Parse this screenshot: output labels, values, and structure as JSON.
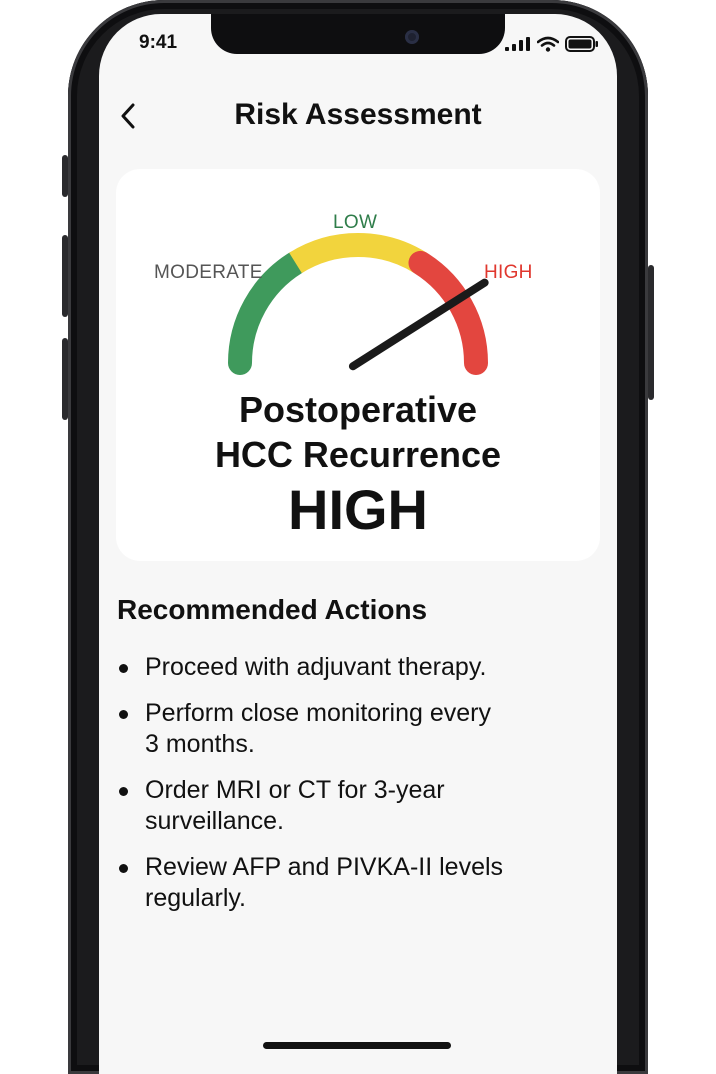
{
  "status_bar": {
    "time": "9:41",
    "icons": [
      "cellular-signal-icon",
      "wifi-icon",
      "battery-icon"
    ]
  },
  "nav": {
    "back_icon": "chevron-left-icon",
    "title": "Risk Assessment"
  },
  "gauge": {
    "labels": {
      "low": "LOW",
      "moderate": "MODERATE",
      "high": "HIGH"
    },
    "colors": {
      "low": "#f2d43d",
      "moderate": "#3f9a5c",
      "high": "#e3463f",
      "low_label": "#2f7d4a",
      "moderate_label": "#555555",
      "high_label": "#e0372e"
    },
    "needle_level": 0.82
  },
  "result": {
    "title_line1": "Postoperative",
    "title_line2": "HCC Recurrence",
    "level": "HIGH"
  },
  "recommendations": {
    "title": "Recommended Actions",
    "items": [
      {
        "line1": "Proceed with adjuvant therapy.",
        "line2": ""
      },
      {
        "line1": "Perform close monitoring every",
        "line2": "3 months."
      },
      {
        "line1": "Order MRI or CT  for 3-year",
        "line2": "surveillance."
      },
      {
        "line1": "Review AFP and PIVKA-II levels",
        "line2": "regularly."
      }
    ]
  }
}
